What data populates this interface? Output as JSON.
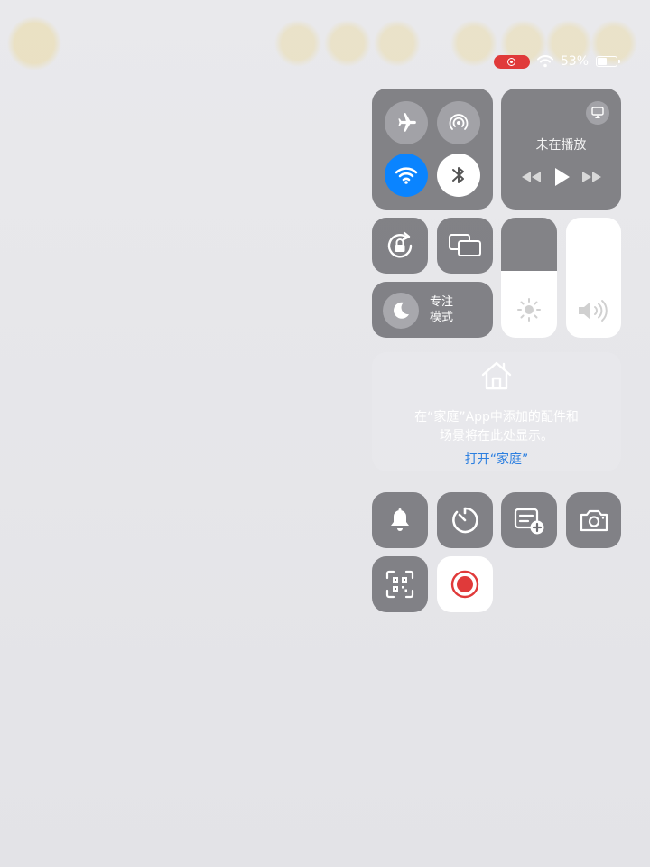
{
  "status_bar": {
    "battery": "53%",
    "battery_fill_fraction": 0.53
  },
  "now_playing": {
    "title": "未在播放"
  },
  "focus": {
    "line1": "专注",
    "line2": "模式"
  },
  "sliders": {
    "brightness_fraction": 0.56,
    "volume_fraction": 1.0
  },
  "home": {
    "message_line1": "在“家庭”App中添加的配件和",
    "message_line2": "场景将在此处显示。",
    "open_link": "打开“家庭”"
  },
  "colors": {
    "accent_blue": "#0a84ff",
    "link_blue": "#2c7fe0",
    "record_red": "#e03a3a"
  },
  "icons": [
    "airplane-icon",
    "airdrop-icon",
    "wifi-icon",
    "bluetooth-icon",
    "airplay-icon",
    "rewind-icon",
    "play-icon",
    "fast-forward-icon",
    "rotation-lock-icon",
    "screen-mirroring-icon",
    "moon-icon",
    "sun-icon",
    "speaker-icon",
    "home-icon",
    "bell-icon",
    "timer-icon",
    "notes-add-icon",
    "camera-icon",
    "qr-scanner-icon",
    "screen-record-icon"
  ]
}
